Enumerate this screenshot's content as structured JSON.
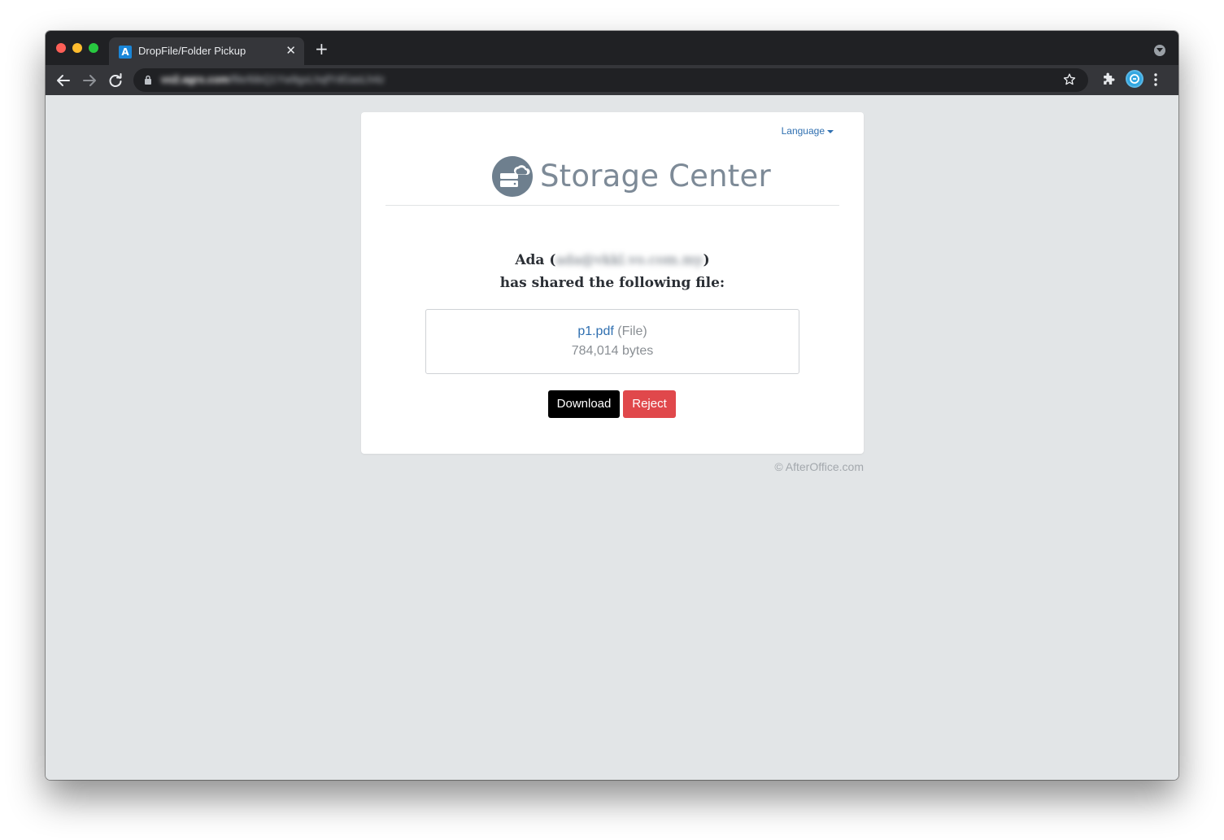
{
  "browser": {
    "tab_title": "DropFile/Folder Pickup",
    "tab_favicon_letter": "A",
    "tab_close": "✕",
    "new_tab": "+",
    "url_host": "vo2.agrx.com",
    "url_path": "/file/6ibQ1Yw9gxLhqfYdGasLh4z"
  },
  "page": {
    "language_label": "Language",
    "brand_name": "Storage Center",
    "sharer_name": "Ada",
    "sharer_email": "ada@vkkl.vo.com.my",
    "shared_message": "has shared the following file:",
    "file": {
      "name": "p1.pdf",
      "type": "(File)",
      "size": "784,014 bytes"
    },
    "download_label": "Download",
    "reject_label": "Reject",
    "footer": "© AfterOffice.com"
  },
  "icons": {
    "back": "arrow-left-icon",
    "forward": "arrow-right-icon",
    "reload": "reload-icon",
    "lock": "lock-icon",
    "bookmark": "star-icon",
    "extensions": "puzzle-icon",
    "menu": "more-vert-icon",
    "logo": "cloud-storage-icon"
  },
  "colors": {
    "download_button": "#000000",
    "reject_button": "#e0484b",
    "link": "#2f6fb0",
    "brand_text": "#7d8a97",
    "page_background": "#e2e5e7"
  }
}
